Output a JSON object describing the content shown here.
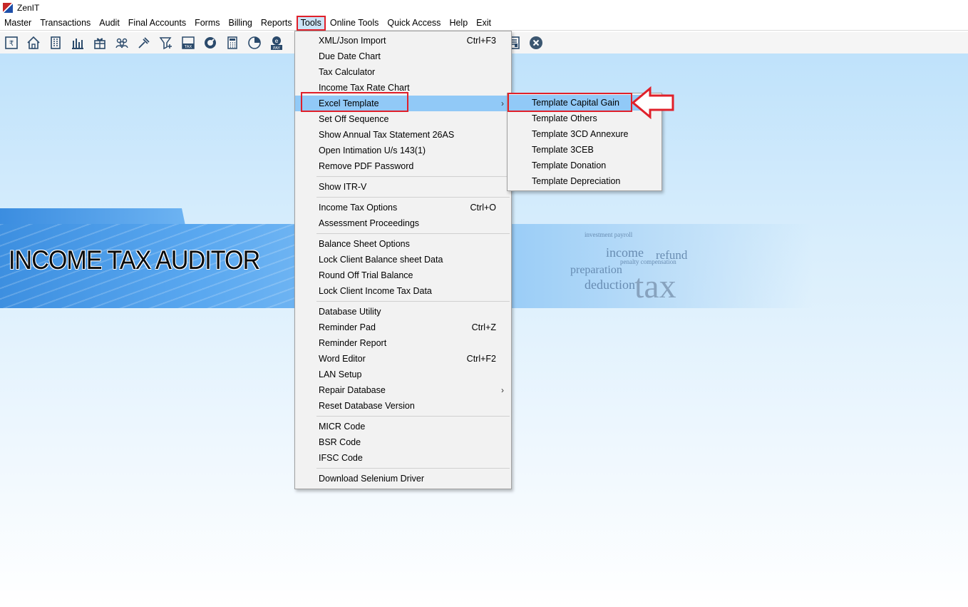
{
  "app": {
    "title": "ZenIT"
  },
  "menubar": {
    "items": [
      "Master",
      "Transactions",
      "Audit",
      "Final Accounts",
      "Forms",
      "Billing",
      "Reports",
      "Tools",
      "Online Tools",
      "Quick Access",
      "Help",
      "Exit"
    ],
    "active": "Tools"
  },
  "toolbar": {
    "icons": [
      "rupee-doc-icon",
      "home-icon",
      "building-icon",
      "bar-chart-icon",
      "gift-icon",
      "users-icon",
      "hammer-icon",
      "filter-icon",
      "tax-icon",
      "gauge-icon",
      "calculator-icon",
      "pie-chart-icon",
      "e-pay-icon",
      "ledger-icon",
      "close-circle-icon"
    ]
  },
  "banner": {
    "title": "INCOME TAX AUDITOR"
  },
  "tools_menu": {
    "items": [
      {
        "label": "XML/Json Import",
        "shortcut": "Ctrl+F3"
      },
      {
        "label": "Due Date Chart"
      },
      {
        "label": "Tax Calculator"
      },
      {
        "label": "Income Tax Rate Chart"
      },
      {
        "label": "Excel Template",
        "submenu": true
      },
      {
        "label": "Set Off Sequence"
      },
      {
        "label": "Show Annual Tax Statement 26AS"
      },
      {
        "label": "Open Intimation U/s 143(1)"
      },
      {
        "label": "Remove PDF Password"
      },
      {
        "label": "Show ITR-V"
      },
      {
        "label": "Income Tax Options",
        "shortcut": "Ctrl+O"
      },
      {
        "label": "Assessment Proceedings"
      },
      {
        "label": "Balance Sheet Options"
      },
      {
        "label": "Lock Client Balance sheet Data"
      },
      {
        "label": "Round Off Trial Balance"
      },
      {
        "label": "Lock Client Income Tax Data"
      },
      {
        "label": "Database Utility"
      },
      {
        "label": "Reminder Pad",
        "shortcut": "Ctrl+Z"
      },
      {
        "label": "Reminder Report"
      },
      {
        "label": "Word Editor",
        "shortcut": "Ctrl+F2"
      },
      {
        "label": "LAN Setup"
      },
      {
        "label": "Repair Database",
        "submenu": true
      },
      {
        "label": "Reset Database Version"
      },
      {
        "label": "MICR Code"
      },
      {
        "label": "BSR Code"
      },
      {
        "label": "IFSC Code"
      },
      {
        "label": "Download Selenium Driver"
      }
    ],
    "highlighted": "Excel Template"
  },
  "excel_template_menu": {
    "items": [
      "Template Capital Gain",
      "Template Others",
      "Template 3CD Annexure",
      "Template 3CEB",
      "Template Donation",
      "Template Depreciation"
    ],
    "highlighted": "Template Capital Gain"
  },
  "colors": {
    "highlight": "#91c9f7",
    "annotation": "#e0202a",
    "menu_bg": "#f2f2f2"
  }
}
